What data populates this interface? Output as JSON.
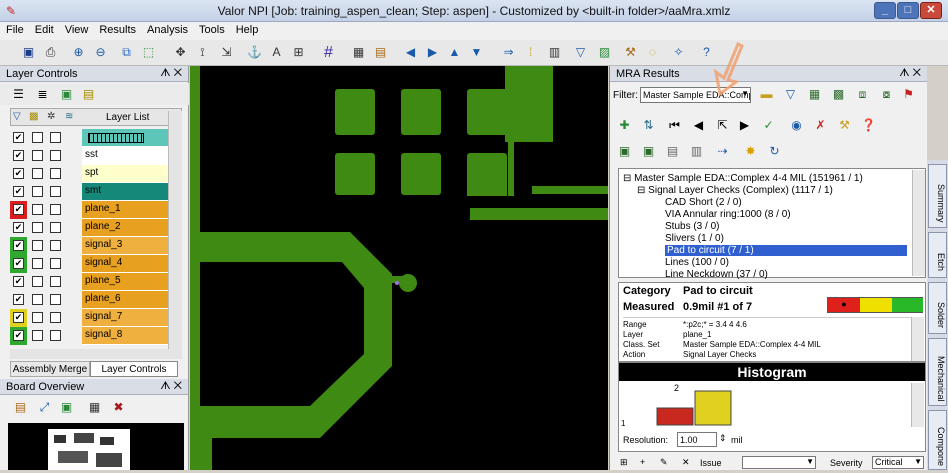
{
  "window": {
    "title": "Valor NPI [Job: training_aspen_clean; Step: aspen] - Customized by <built-in folder>/aaMra.xmlz"
  },
  "menu": [
    "File",
    "Edit",
    "View",
    "Results",
    "Analysis",
    "Tools",
    "Help"
  ],
  "layer_controls": {
    "title": "Layer Controls",
    "column_header": "Layer List",
    "layers": [
      {
        "name": "",
        "color": "#5ec6b8",
        "checked": true
      },
      {
        "name": "sst",
        "color": "#ffffff",
        "checked": true
      },
      {
        "name": "spt",
        "color": "#ffffcc",
        "checked": true
      },
      {
        "name": "smt",
        "color": "#15887a",
        "checked": true
      },
      {
        "name": "plane_1",
        "color": "#e8a020",
        "checked": true,
        "chip": "#d81e1e"
      },
      {
        "name": "plane_2",
        "color": "#e8a020",
        "checked": true
      },
      {
        "name": "signal_3",
        "color": "#f0b040",
        "checked": true,
        "chip": "#2fa82f"
      },
      {
        "name": "signal_4",
        "color": "#e8a020",
        "checked": true,
        "chip": "#2fa82f"
      },
      {
        "name": "plane_5",
        "color": "#e8a020",
        "checked": true
      },
      {
        "name": "plane_6",
        "color": "#e8a020",
        "checked": true
      },
      {
        "name": "signal_7",
        "color": "#f0b040",
        "checked": true,
        "chip": "#e0d020"
      },
      {
        "name": "signal_8",
        "color": "#f0b040",
        "checked": true,
        "chip": "#2fa82f"
      }
    ],
    "tabs": [
      "Assembly Merge",
      "Layer Controls"
    ]
  },
  "board_overview": {
    "title": "Board Overview"
  },
  "mra": {
    "title": "MRA Results",
    "filter_label": "Filter:",
    "filter_value": "Master Sample EDA::Comp",
    "tree": [
      {
        "text": "Master Sample EDA::Complex 4-4 MIL (151961 / 1)",
        "indent": 0,
        "sign": "⊟"
      },
      {
        "text": "Signal Layer Checks (Complex) (1117 / 1)",
        "indent": 1,
        "sign": "⊟"
      },
      {
        "text": "CAD Short (2 / 0)",
        "indent": 2
      },
      {
        "text": "VIA Annular ring:1000 (8 / 0)",
        "indent": 2
      },
      {
        "text": "Stubs (3 / 0)",
        "indent": 2
      },
      {
        "text": "Slivers (1 / 0)",
        "indent": 2
      },
      {
        "text": "Pad to circuit (7 / 1)",
        "indent": 2,
        "selected": true
      },
      {
        "text": "Lines (100 / 0)",
        "indent": 2
      },
      {
        "text": "Line Neckdown (37 / 0)",
        "indent": 2
      }
    ],
    "detail": {
      "category_label": "Category",
      "category_value": "Pad to circuit",
      "measured_label": "Measured",
      "measured_value": "0.9mil #1 of 7",
      "rows": [
        {
          "k": "Range",
          "v": "*:p2c;* = 3.4 4 4.6"
        },
        {
          "k": "Layer",
          "v": "plane_1"
        },
        {
          "k": "Class. Set",
          "v": "Master Sample EDA::Complex 4-4 MIL"
        },
        {
          "k": "Action",
          "v": "Signal Layer Checks"
        }
      ]
    },
    "histogram": {
      "title": "Histogram",
      "bar_label": "2",
      "y_tick": "1",
      "bars": [
        {
          "color": "#c8281e",
          "value": 1
        },
        {
          "color": "#e0d020",
          "value": 2
        }
      ],
      "resolution_label": "Resolution:",
      "resolution_value": "1.00",
      "resolution_unit": "mil"
    },
    "bottom": {
      "issue_label": "Issue",
      "severity_label": "Severity",
      "severity_value": "Critical"
    },
    "side_tabs": [
      "Summary",
      "Etch",
      "Solder",
      "Mechanical",
      "Compone"
    ]
  }
}
